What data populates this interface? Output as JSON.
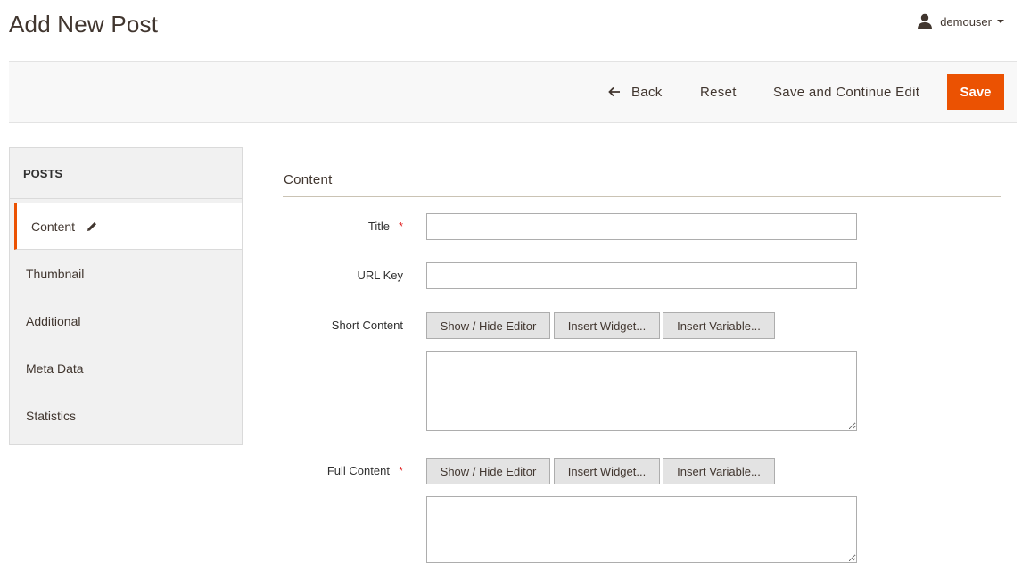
{
  "page": {
    "title": "Add New Post"
  },
  "user": {
    "name": "demouser"
  },
  "actions": {
    "back": "Back",
    "reset": "Reset",
    "save_continue": "Save and Continue Edit",
    "save": "Save"
  },
  "sidebar": {
    "title": "POSTS",
    "items": [
      {
        "label": "Content",
        "active": true
      },
      {
        "label": "Thumbnail"
      },
      {
        "label": "Additional"
      },
      {
        "label": "Meta Data"
      },
      {
        "label": "Statistics"
      }
    ]
  },
  "form": {
    "section_title": "Content",
    "title_label": "Title",
    "url_key_label": "URL Key",
    "short_content_label": "Short Content",
    "full_content_label": "Full Content",
    "title_value": "",
    "url_key_value": "",
    "required_mark": "*",
    "editor_buttons": {
      "toggle": "Show / Hide Editor",
      "widget": "Insert Widget...",
      "variable": "Insert Variable..."
    }
  },
  "colors": {
    "accent": "#eb5202",
    "required": "#e22626"
  }
}
